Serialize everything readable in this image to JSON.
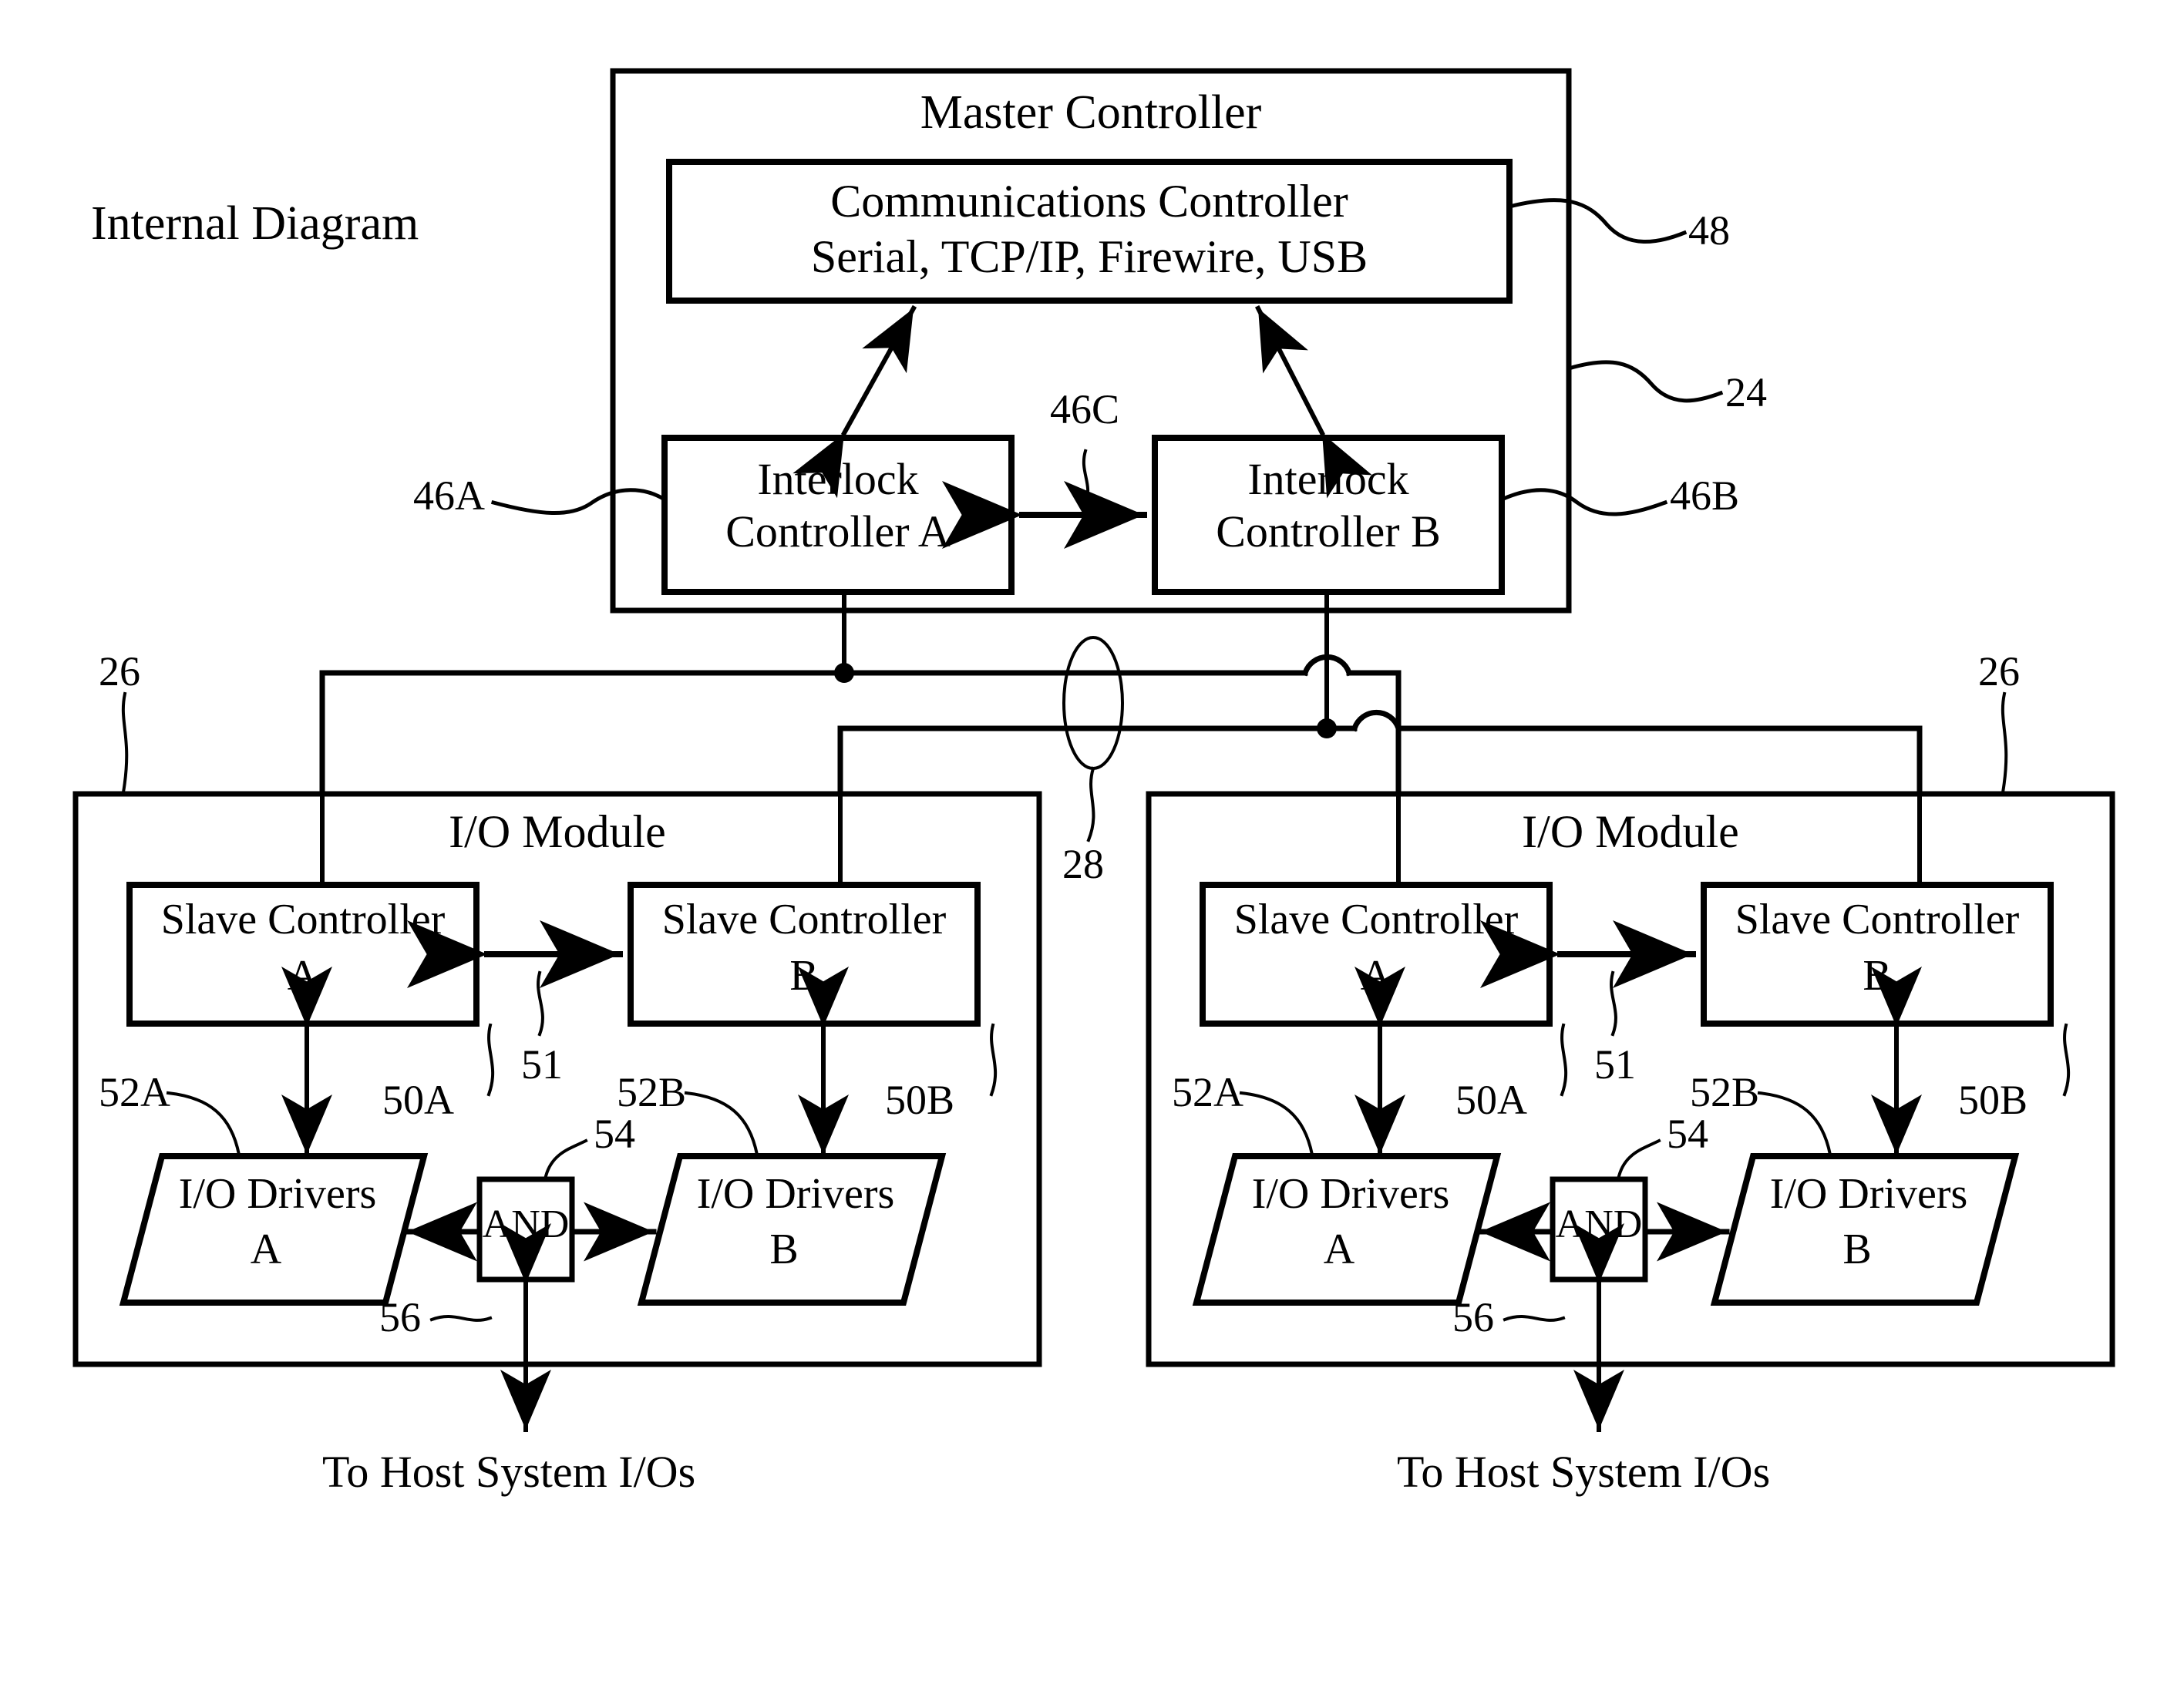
{
  "figure": {
    "caption": "Internal Diagram",
    "style": "patent-line-drawing",
    "ink_color": "#000000",
    "paper_color": "#ffffff"
  },
  "master_controller": {
    "title": "Master Controller",
    "ref": "24",
    "communications_controller": {
      "line1": "Communications Controller",
      "line2": "Serial, TCP/IP, Firewire, USB",
      "ref": "48"
    },
    "interlock_a": {
      "line1": "Interlock",
      "line2": "Controller A",
      "ref": "46A"
    },
    "interlock_b": {
      "line1": "Interlock",
      "line2": "Controller B",
      "ref": "46B"
    },
    "interlock_link_ref": "46C"
  },
  "bus": {
    "ref": "28"
  },
  "io_modules": [
    {
      "title": "I/O Module",
      "ref": "26",
      "slave_a": {
        "line1": "Slave Controller",
        "line2": "A",
        "ref": "50A"
      },
      "slave_b": {
        "line1": "Slave Controller",
        "line2": "B",
        "ref": "50B"
      },
      "slave_link_ref": "51",
      "drivers_a": {
        "line1": "I/O Drivers",
        "line2": "A",
        "ref": "52A"
      },
      "drivers_b": {
        "line1": "I/O Drivers",
        "line2": "B",
        "ref": "52B"
      },
      "and_gate": {
        "label": "AND",
        "ref": "54"
      },
      "host_link_ref": "56",
      "host_caption": "To Host System I/Os"
    },
    {
      "title": "I/O Module",
      "ref": "26",
      "slave_a": {
        "line1": "Slave Controller",
        "line2": "A",
        "ref": "50A"
      },
      "slave_b": {
        "line1": "Slave Controller",
        "line2": "B",
        "ref": "50B"
      },
      "slave_link_ref": "51",
      "drivers_a": {
        "line1": "I/O Drivers",
        "line2": "A",
        "ref": "52A"
      },
      "drivers_b": {
        "line1": "I/O Drivers",
        "line2": "B",
        "ref": "52B"
      },
      "and_gate": {
        "label": "AND",
        "ref": "54"
      },
      "host_link_ref": "56",
      "host_caption": "To Host System I/Os"
    }
  ]
}
